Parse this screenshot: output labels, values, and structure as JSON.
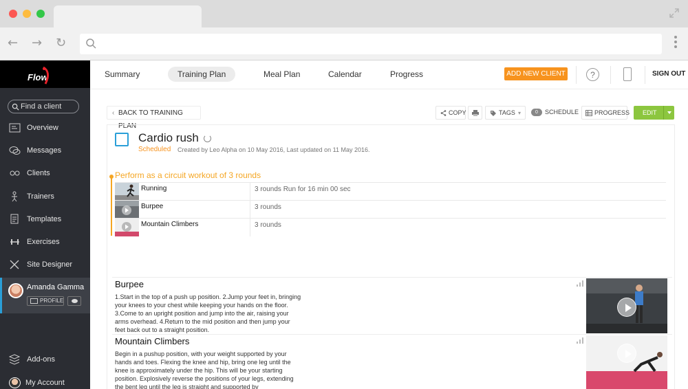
{
  "sidebar": {
    "logo": "Flow",
    "search_placeholder": "Find a client",
    "items": [
      {
        "label": "Overview",
        "icon": "overview-icon"
      },
      {
        "label": "Messages",
        "icon": "messages-icon"
      },
      {
        "label": "Clients",
        "icon": "clients-icon"
      },
      {
        "label": "Trainers",
        "icon": "trainers-icon"
      },
      {
        "label": "Templates",
        "icon": "templates-icon"
      },
      {
        "label": "Exercises",
        "icon": "dumbbell-icon"
      },
      {
        "label": "Site Designer",
        "icon": "site-designer-icon"
      }
    ],
    "user": {
      "name": "Amanda Gamma",
      "profile_label": "PROFILE"
    },
    "bottom_items": [
      {
        "label": "Add-ons",
        "icon": "addons-icon"
      },
      {
        "label": "My Account",
        "icon": "account-avatar-icon"
      }
    ]
  },
  "topnav": {
    "tabs": [
      "Summary",
      "Training Plan",
      "Meal Plan",
      "Calendar",
      "Progress"
    ],
    "active_tab": "Training Plan",
    "add_client_label": "ADD NEW CLIENT",
    "signout_label": "SIGN OUT"
  },
  "toolbar": {
    "back_label": "BACK TO TRAINING PLAN",
    "copy_label": "COPY",
    "tags_label": "TAGS",
    "schedule_count": "0",
    "schedule_label": "SCHEDULE",
    "progress_label": "PROGRESS",
    "edit_label": "EDIT"
  },
  "plan": {
    "title": "Cardio rush",
    "status": "Scheduled",
    "meta": "Created by Leo Alpha on 10 May 2016, Last updated on 11 May 2016.",
    "circuit_title": "Perform as a circuit workout of 3 rounds",
    "exercises": [
      {
        "name": "Running",
        "detail": "3 rounds Run for 16 min 00 sec"
      },
      {
        "name": "Burpee",
        "detail": "3 rounds"
      },
      {
        "name": "Mountain Climbers",
        "detail": "3 rounds"
      }
    ]
  },
  "descriptions": [
    {
      "title": "Burpee",
      "text": "1.Start in the top of a push up position. 2.Jump your feet in, bringing your knees to your chest while keeping your hands on the floor. 3.Come to an upright position and jump into the air, raising your arms overhead. 4.Return to the mid position and then jump your feet back out to a straight position."
    },
    {
      "title": "Mountain Climbers",
      "text": "Begin in a pushup position, with your weight supported by your hands and toes. Flexing the knee and hip, bring one leg until the knee is approximately under the hip. This will be your starting position. Explosively reverse the positions of your legs, extending the bent leg until the leg is straight and supported by"
    }
  ],
  "colors": {
    "accent_orange": "#f7931e",
    "accent_blue": "#2a9fd8",
    "accent_green": "#8cc63f",
    "sidebar_bg": "#2b2d33"
  }
}
